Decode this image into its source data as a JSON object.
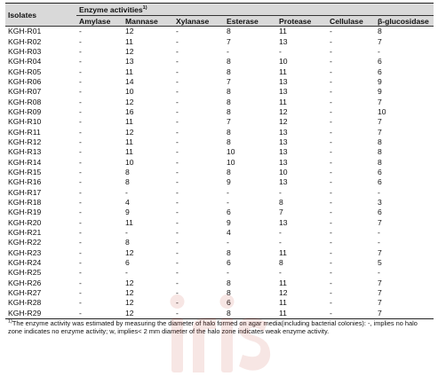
{
  "table": {
    "header": {
      "isolates": "Isolates",
      "group": "Enzyme activities",
      "group_sup": "1)",
      "columns": [
        "Amylase",
        "Mannase",
        "Xylanase",
        "Esterase",
        "Protease",
        "Cellulase",
        "β-glucosidase"
      ]
    },
    "rows": [
      [
        "KGH-R01",
        "-",
        "12",
        "-",
        "8",
        "11",
        "-",
        "8"
      ],
      [
        "KGH-R02",
        "-",
        "11",
        "-",
        "7",
        "13",
        "-",
        "7"
      ],
      [
        "KGH-R03",
        "-",
        "12",
        "-",
        "-",
        "-",
        "-",
        "-"
      ],
      [
        "KGH-R04",
        "-",
        "13",
        "-",
        "8",
        "10",
        "-",
        "6"
      ],
      [
        "KGH-R05",
        "-",
        "11",
        "-",
        "8",
        "11",
        "-",
        "6"
      ],
      [
        "KGH-R06",
        "-",
        "14",
        "-",
        "7",
        "13",
        "-",
        "9"
      ],
      [
        "KGH-R07",
        "-",
        "10",
        "-",
        "8",
        "13",
        "-",
        "9"
      ],
      [
        "KGH-R08",
        "-",
        "12",
        "-",
        "8",
        "11",
        "-",
        "7"
      ],
      [
        "KGH-R09",
        "-",
        "16",
        "-",
        "8",
        "12",
        "-",
        "10"
      ],
      [
        "KGH-R10",
        "-",
        "11",
        "-",
        "7",
        "12",
        "-",
        "7"
      ],
      [
        "KGH-R11",
        "-",
        "12",
        "-",
        "8",
        "13",
        "-",
        "7"
      ],
      [
        "KGH-R12",
        "-",
        "11",
        "-",
        "8",
        "13",
        "-",
        "8"
      ],
      [
        "KGH-R13",
        "-",
        "11",
        "-",
        "10",
        "13",
        "-",
        "8"
      ],
      [
        "KGH-R14",
        "-",
        "10",
        "-",
        "10",
        "13",
        "-",
        "8"
      ],
      [
        "KGH-R15",
        "-",
        "8",
        "-",
        "8",
        "10",
        "-",
        "6"
      ],
      [
        "KGH-R16",
        "-",
        "8",
        "-",
        "9",
        "13",
        "-",
        "6"
      ],
      [
        "KGH-R17",
        "-",
        "-",
        "-",
        "-",
        "-",
        "-",
        "-"
      ],
      [
        "KGH-R18",
        "-",
        "4",
        "-",
        "-",
        "8",
        "-",
        "3"
      ],
      [
        "KGH-R19",
        "-",
        "9",
        "-",
        "6",
        "7",
        "-",
        "6"
      ],
      [
        "KGH-R20",
        "-",
        "11",
        "-",
        "9",
        "13",
        "-",
        "7"
      ],
      [
        "KGH-R21",
        "-",
        "-",
        "-",
        "4",
        "-",
        "-",
        "-"
      ],
      [
        "KGH-R22",
        "-",
        "8",
        "-",
        "-",
        "-",
        "-",
        "-"
      ],
      [
        "KGH-R23",
        "-",
        "12",
        "-",
        "8",
        "11",
        "-",
        "7"
      ],
      [
        "KGH-R24",
        "-",
        "6",
        "-",
        "6",
        "8",
        "-",
        "5"
      ],
      [
        "KGH-R25",
        "-",
        "-",
        "-",
        "-",
        "-",
        "-",
        "-"
      ],
      [
        "KGH-R26",
        "-",
        "12",
        "-",
        "8",
        "11",
        "-",
        "7"
      ],
      [
        "KGH-R27",
        "-",
        "12",
        "-",
        "8",
        "12",
        "-",
        "7"
      ],
      [
        "KGH-R28",
        "-",
        "12",
        "-",
        "6",
        "11",
        "-",
        "7"
      ],
      [
        "KGH-R29",
        "-",
        "12",
        "-",
        "8",
        "11",
        "-",
        "7"
      ]
    ]
  },
  "footnote": {
    "sup": "1)",
    "text": "The enzyme activity was estimated by measuring the diameter of halo formed on agar media(including bacterial colonies): -, implies no halo zone indicates no enzyme activity; w, implies< 2 mm diameter of the halo zone indicates weak enzyme activity."
  },
  "colors": {
    "header_bg": "#d9d9d9",
    "watermark": "#c0392b"
  }
}
